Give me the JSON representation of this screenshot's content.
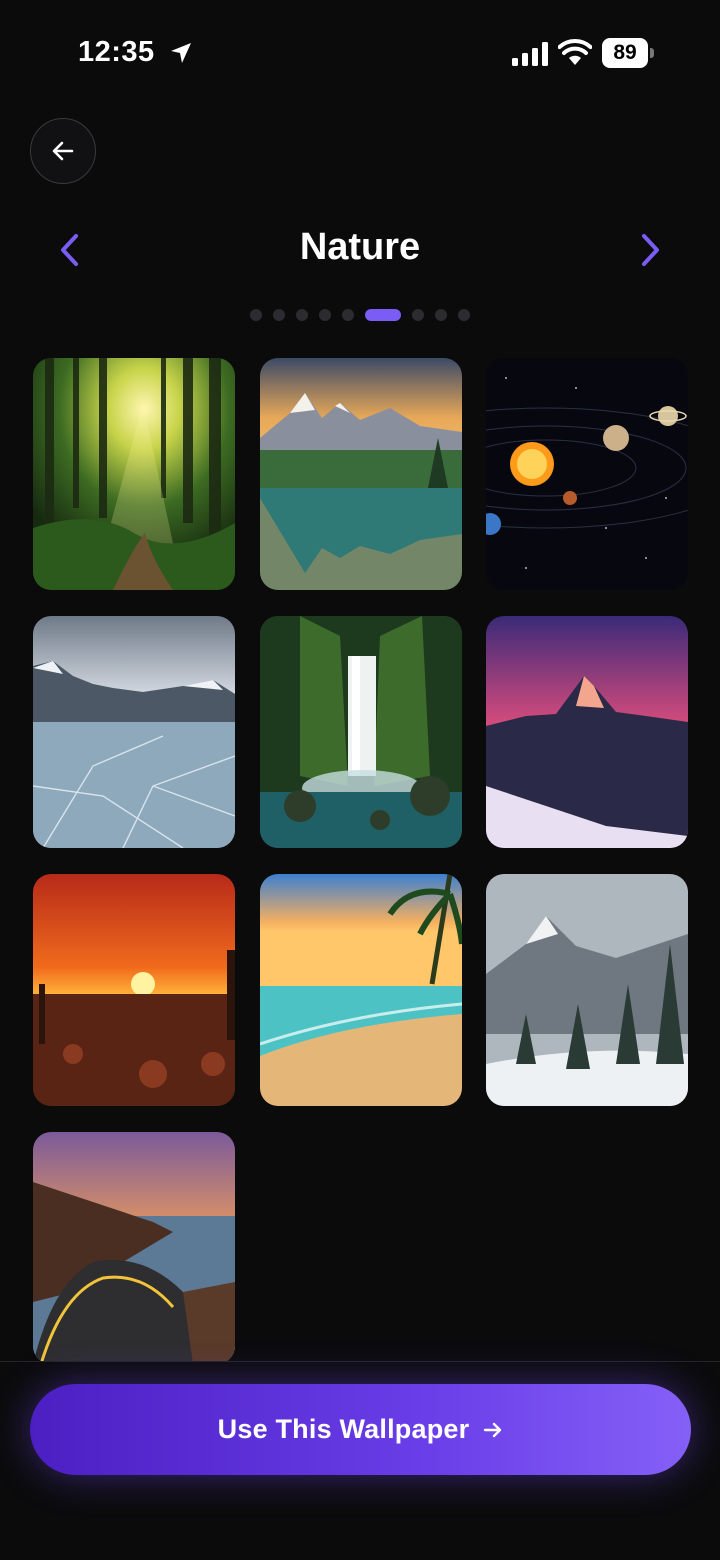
{
  "status_bar": {
    "time": "12:35",
    "battery": "89"
  },
  "header": {
    "title": "Nature"
  },
  "pager": {
    "total": 9,
    "active_index": 5
  },
  "wallpapers": [
    {
      "subject": "forest-sunbeams"
    },
    {
      "subject": "mountain-lake"
    },
    {
      "subject": "solar-system"
    },
    {
      "subject": "frozen-lake"
    },
    {
      "subject": "waterfall"
    },
    {
      "subject": "pink-mountain-peak"
    },
    {
      "subject": "desert-sunset"
    },
    {
      "subject": "tropical-beach"
    },
    {
      "subject": "snowy-forest"
    },
    {
      "subject": "coastal-road"
    }
  ],
  "cta": {
    "label": "Use This Wallpaper"
  },
  "colors": {
    "accent": "#7b5cf5",
    "background": "#0b0b0c"
  }
}
